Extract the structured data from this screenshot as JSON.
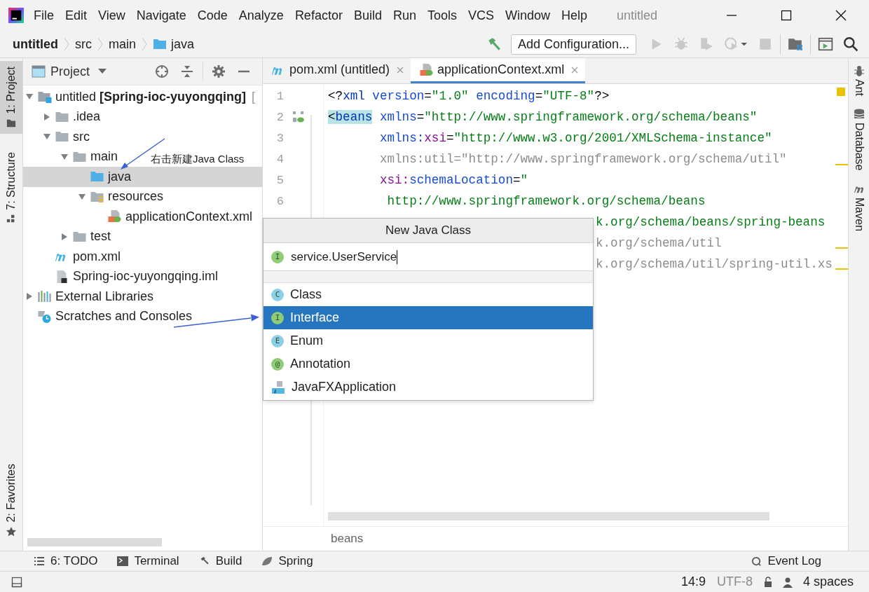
{
  "menu_bar": {
    "items": [
      "File",
      "Edit",
      "View",
      "Navigate",
      "Code",
      "Analyze",
      "Refactor",
      "Build",
      "Run",
      "Tools",
      "VCS",
      "Window",
      "Help"
    ],
    "title": "untitled"
  },
  "nav_bar": {
    "breadcrumbs": [
      {
        "label": "untitled",
        "kind": "project"
      },
      {
        "label": "src",
        "kind": "plain"
      },
      {
        "label": "main",
        "kind": "plain"
      },
      {
        "label": "java",
        "kind": "folder"
      }
    ],
    "run_config": "Add Configuration..."
  },
  "left_strip": {
    "top": [
      {
        "label": "1: Project",
        "kind": "project",
        "selected": true
      },
      {
        "label": "7: Structure",
        "kind": "structure",
        "selected": false
      }
    ],
    "bottom": [
      {
        "label": "2: Favorites",
        "kind": "favorites",
        "selected": false
      }
    ]
  },
  "project_panel": {
    "title": "Project",
    "tree": [
      {
        "label": "untitled **[Spring-ioc-yuyongqing]**",
        "suffix": "[",
        "kind": "module",
        "expanded": true,
        "selected": false,
        "children": [
          {
            "label": ".idea",
            "kind": "folder",
            "expanded": false,
            "selected": false
          },
          {
            "label": "src",
            "kind": "folder",
            "expanded": true,
            "selected": false,
            "children": [
              {
                "label": "main",
                "kind": "folder",
                "expanded": true,
                "selected": false,
                "children": [
                  {
                    "label": "java",
                    "kind": "source-folder",
                    "selected": true
                  },
                  {
                    "label": "resources",
                    "kind": "resources",
                    "expanded": true,
                    "selected": false,
                    "children": [
                      {
                        "label": "applicationContext.xml",
                        "kind": "spring-xml",
                        "selected": false
                      }
                    ]
                  }
                ]
              },
              {
                "label": "test",
                "kind": "folder",
                "expanded": false,
                "selected": false
              }
            ]
          },
          {
            "label": "pom.xml",
            "kind": "maven",
            "selected": false
          },
          {
            "label": "Spring-ioc-yuyongqing.iml",
            "kind": "iml",
            "selected": false
          }
        ]
      },
      {
        "label": "External Libraries",
        "kind": "libraries",
        "expanded": false,
        "selected": false
      },
      {
        "label": "Scratches and Consoles",
        "kind": "scratches",
        "selected": false
      }
    ]
  },
  "editor": {
    "tabs": [
      {
        "label": "pom.xml (untitled)",
        "kind": "maven",
        "selected": false
      },
      {
        "label": "applicationContext.xml",
        "kind": "spring-xml",
        "selected": true
      }
    ],
    "lines": [
      {
        "number": "1",
        "tokens": [
          {
            "kind": "plain",
            "text": "<?"
          },
          {
            "kind": "tag",
            "text": "xml"
          },
          {
            "kind": "attr",
            "text": " version"
          },
          {
            "kind": "plain",
            "text": "="
          },
          {
            "kind": "value",
            "text": "\"1.0\""
          },
          {
            "kind": "attr",
            "text": " encoding"
          },
          {
            "kind": "plain",
            "text": "="
          },
          {
            "kind": "value",
            "text": "\"UTF-8\""
          },
          {
            "kind": "plain",
            "text": "?>"
          }
        ]
      },
      {
        "number": "2",
        "gutter_icon": true,
        "tokens": [
          {
            "kind": "match-plain",
            "text": "<"
          },
          {
            "kind": "match",
            "text": "beans"
          },
          {
            "kind": "attr",
            "text": " xmlns"
          },
          {
            "kind": "plain",
            "text": "="
          },
          {
            "kind": "value",
            "text": "\"http://www.springframework.org/schema/beans\""
          }
        ]
      },
      {
        "number": "3",
        "tokens": [
          {
            "kind": "attr",
            "text": "       xmlns:"
          },
          {
            "kind": "ns",
            "text": "xsi"
          },
          {
            "kind": "plain",
            "text": "="
          },
          {
            "kind": "value",
            "text": "\"http://www.w3.org/2001/XMLSchema-instance\""
          }
        ]
      },
      {
        "number": "4",
        "tokens": [
          {
            "kind": "unused",
            "text": "       xmlns:util=\"http://www.springframework.org/schema/util\""
          }
        ]
      },
      {
        "number": "5",
        "tokens": [
          {
            "kind": "ns",
            "text": "       xsi:"
          },
          {
            "kind": "attr",
            "text": "schemaLocation"
          },
          {
            "kind": "plain",
            "text": "="
          },
          {
            "kind": "value",
            "text": "\""
          }
        ]
      },
      {
        "number": "6",
        "tokens": [
          {
            "kind": "value",
            "text": "        http://www.springframework.org/schema/beans"
          }
        ]
      },
      {
        "kind": "partial",
        "tokens": [
          {
            "kind": "value",
            "text": "k.org/schema/beans/spring-beans"
          }
        ]
      },
      {
        "kind": "partial",
        "tokens": [
          {
            "kind": "unused",
            "text": "k.org/schema/util"
          }
        ]
      },
      {
        "kind": "partial",
        "tokens": [
          {
            "kind": "unused",
            "text": "k.org/schema/util/spring-util.xs"
          }
        ]
      }
    ],
    "breadcrumb": "beans"
  },
  "right_strip": [
    {
      "label": "Ant",
      "kind": "ant"
    },
    {
      "label": "Database",
      "kind": "database"
    },
    {
      "label": "Maven",
      "kind": "maven"
    }
  ],
  "popup": {
    "title": "New Java Class",
    "field": {
      "value": "service.UserService",
      "badge": "I",
      "color": "#8fcc78"
    },
    "items": [
      {
        "label": "Class",
        "kind": "badge",
        "badge": "C",
        "color": "#8ccfe6",
        "selected": false
      },
      {
        "label": "Interface",
        "kind": "badge",
        "badge": "I",
        "color": "#8fcc78",
        "selected": true
      },
      {
        "label": "Enum",
        "kind": "badge",
        "badge": "E",
        "color": "#8ccfe6",
        "selected": false
      },
      {
        "label": "Annotation",
        "kind": "badge",
        "badge": "@",
        "color": "#8fcc78",
        "selected": false
      },
      {
        "label": "JavaFXApplication",
        "kind": "javafx",
        "selected": false
      }
    ]
  },
  "annotation": "右击新建Java Class",
  "bottom_toolbar": [
    {
      "label": "6: TODO",
      "kind": "todo"
    },
    {
      "label": "Terminal",
      "kind": "terminal"
    },
    {
      "label": "Build",
      "kind": "build"
    },
    {
      "label": "Spring",
      "kind": "spring"
    }
  ],
  "event_log": "Event Log",
  "status_bar": {
    "caret": "14:9",
    "encoding": "UTF-8",
    "indent": "4 spaces"
  }
}
